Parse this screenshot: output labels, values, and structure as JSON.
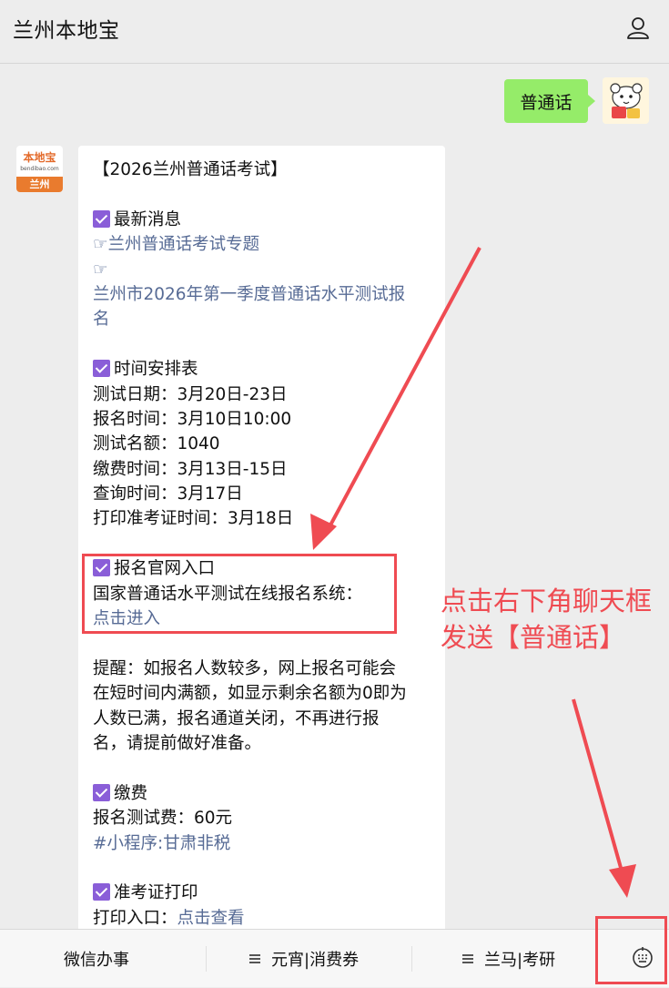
{
  "header": {
    "title": "兰州本地宝",
    "user_icon": "user-icon"
  },
  "chat": {
    "user_message": "普通话",
    "reply_avatar": {
      "brand": "本地宝",
      "site": "bendibao.com",
      "city": "兰州"
    },
    "reply": {
      "heading": "【2026兰州普通话考试】",
      "s1_title": "最新消息",
      "s1_link1_prefix": "☞",
      "s1_link1": "兰州普通话考试专题",
      "s1_link2_prefix": "☞",
      "s1_link2_line1": "兰州市2026年第一季度普通话水平测试报",
      "s1_link2_line2": "名",
      "s2_title": "时间安排表",
      "s2_rows": [
        "测试日期：3月20日-23日",
        "报名时间：3月10日10:00",
        "测试名额：1040",
        "缴费时间：3月13日-15日",
        "查询时间：3月17日",
        "打印准考证时间：3月18日"
      ],
      "s3_title": "报名官网入口",
      "s3_text": "国家普通话水平测试在线报名系统：",
      "s3_link": "点击进入",
      "reminder_lines": [
        "提醒：如报名人数较多，网上报名可能会",
        "在短时间内满额，如显示剩余名额为0即为",
        "人数已满，报名通道关闭，不再进行报",
        "名，请提前做好准备。"
      ],
      "s4_title": "缴费",
      "s4_text": "报名测试费：60元",
      "s4_link": "#小程序:甘肃非税",
      "s5_title": "准考证打印",
      "s5_text": "打印入口：",
      "s5_link": "点击查看"
    }
  },
  "annotation": {
    "line1": "点击右下角聊天框",
    "line2": "发送【普通话】",
    "color": "#ef4b52"
  },
  "bottom_menu": {
    "items": [
      {
        "label": "微信办事"
      },
      {
        "label": "元宵|消费券"
      },
      {
        "label": "兰马|考研"
      }
    ],
    "keyboard_icon": "keyboard-icon"
  },
  "colors": {
    "bubble_green": "#95ec69",
    "link": "#576b95",
    "checkbox": "#8a5ed8",
    "accent_red": "#ef4b52"
  }
}
